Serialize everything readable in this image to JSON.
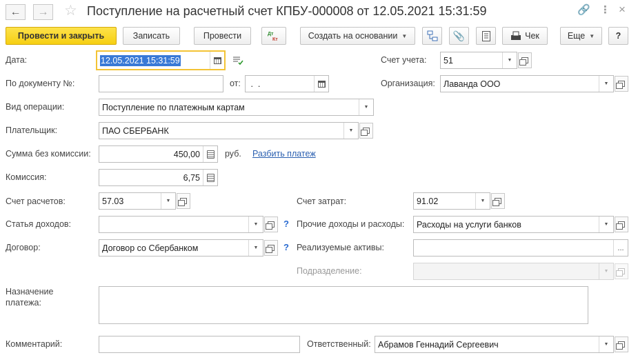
{
  "window": {
    "title": "Поступление на расчетный счет КПБУ-000008 от 12.05.2021 15:31:59",
    "back_icon": "arrow-left-icon",
    "forward_icon": "arrow-right-icon",
    "favorite_icon": "star-icon",
    "link_icon": "link-icon",
    "more_icon": "vertical-dots-icon",
    "close_icon": "close-icon"
  },
  "toolbar": {
    "post_close": "Провести и закрыть",
    "save": "Записать",
    "post": "Провести",
    "dt_kt": "Дт Кт",
    "create_based": "Создать на основании",
    "receipt": "Чек",
    "more": "Еще",
    "help": "?",
    "accent_color": "#f6cf13"
  },
  "form": {
    "date_label": "Дата:",
    "date_value": "12.05.2021 15:31:59",
    "account_label": "Счет учета:",
    "account_value": "51",
    "doc_no_label": "По документу №:",
    "doc_no_value": "",
    "from_label": "от:",
    "from_value": " .  . ",
    "org_label": "Организация:",
    "org_value": "Лаванда ООО",
    "op_type_label": "Вид операции:",
    "op_type_value": "Поступление по платежным картам",
    "payer_label": "Плательщик:",
    "payer_value": "ПАО СБЕРБАНК",
    "amount_label": "Сумма без комиссии:",
    "amount_value": "450,00",
    "currency": "руб.",
    "split_payment": "Разбить платеж",
    "commission_label": "Комиссия:",
    "commission_value": "6,75",
    "settle_account_label": "Счет расчетов:",
    "settle_account_value": "57.03",
    "cost_account_label": "Счет затрат:",
    "cost_account_value": "91.02",
    "income_item_label": "Статья доходов:",
    "income_item_value": "",
    "other_income_label": "Прочие доходы и расходы:",
    "other_income_value": "Расходы на услуги банков",
    "contract_label": "Договор:",
    "contract_value": "Договор со Сбербанком",
    "sold_assets_label": "Реализуемые активы:",
    "sold_assets_value": "",
    "division_label": "Подразделение:",
    "division_value": "",
    "purpose_label_1": "Назначение",
    "purpose_label_2": "платежа:",
    "purpose_value": "",
    "comment_label": "Комментарий:",
    "comment_value": "",
    "responsible_label": "Ответственный:",
    "responsible_value": "Абрамов Геннадий Сергеевич",
    "help_mark": "?",
    "ellipsis": "..."
  }
}
